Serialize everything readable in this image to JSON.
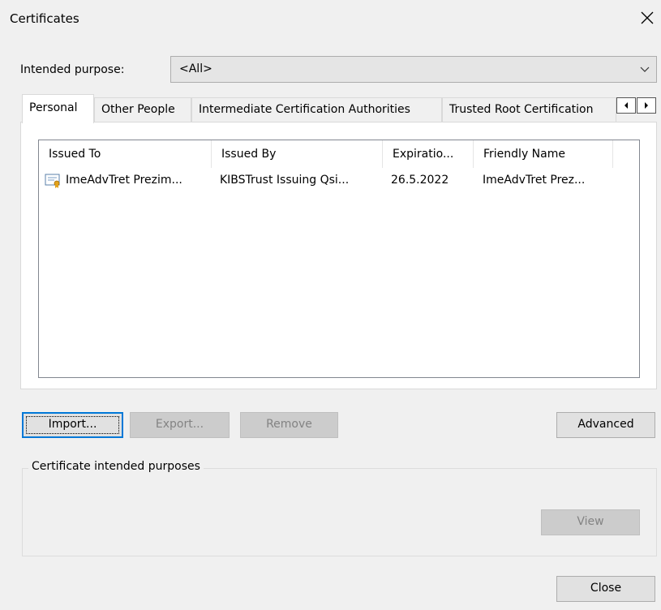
{
  "window": {
    "title": "Certificates"
  },
  "purpose": {
    "label": "Intended purpose:",
    "selected": "<All>"
  },
  "tabs": [
    {
      "label": "Personal",
      "active": true
    },
    {
      "label": "Other People",
      "active": false
    },
    {
      "label": "Intermediate Certification Authorities",
      "active": false
    },
    {
      "label": "Trusted Root Certification",
      "active": false
    }
  ],
  "list": {
    "columns": [
      "Issued To",
      "Issued By",
      "Expiratio...",
      "Friendly Name"
    ],
    "rows": [
      {
        "issued_to": "ImeAdvTret Prezim...",
        "issued_by": "KIBSTrust Issuing Qsi...",
        "expiration": "26.5.2022",
        "friendly_name": "ImeAdvTret Prez..."
      }
    ]
  },
  "buttons": {
    "import": "Import...",
    "export": "Export...",
    "remove": "Remove",
    "advanced": "Advanced",
    "view": "View",
    "close": "Close"
  },
  "group": {
    "legend": "Certificate intended purposes"
  },
  "colors": {
    "dialog_bg": "#f0f0f0",
    "focus_border": "#0078d7",
    "cert_icon_ribbon": "#e3a21a"
  }
}
